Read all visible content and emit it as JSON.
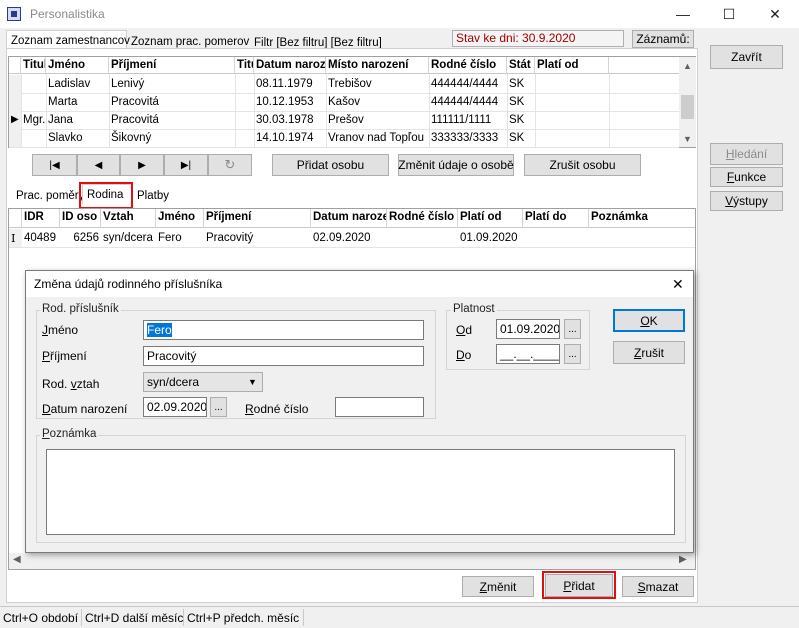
{
  "window": {
    "title": "Personalistika",
    "minimize": "—",
    "maximize": "☐",
    "close": "✕"
  },
  "top_tabs": [
    "Zoznam zamestnancov",
    "Zoznam prac. pomerov",
    "Filtr [Bez filtru] [Bez filtru]"
  ],
  "status_date": "Stav ke dni: 30.9.2020",
  "zaznamu_label": "Záznamů:",
  "zavrit_label": "Zavřít",
  "side_buttons": {
    "hledani": "Hledání",
    "funkce": "Funkce",
    "vystupy": "Výstupy"
  },
  "employees": {
    "columns": [
      "Titul",
      "Jméno",
      "Příjmení",
      "Titul",
      "Datum narození",
      "Místo narození",
      "Rodné číslo",
      "Stát",
      "Platí od"
    ],
    "rows": [
      {
        "indicator": "",
        "titul": "",
        "jmeno": "Ladislav",
        "prijmeni": "Lenivý",
        "titul2": "",
        "datum": "08.11.1979",
        "misto": "Trebišov",
        "rc": "444444/4444",
        "stat": "SK",
        "plati": ""
      },
      {
        "indicator": "",
        "titul": "",
        "jmeno": "Marta",
        "prijmeni": "Pracovitá",
        "titul2": "",
        "datum": "10.12.1953",
        "misto": "Kašov",
        "rc": "444444/4444",
        "stat": "SK",
        "plati": ""
      },
      {
        "indicator": "▶",
        "titul": "Mgr.",
        "jmeno": "Jana",
        "prijmeni": "Pracovitá",
        "titul2": "",
        "datum": "30.03.1978",
        "misto": "Prešov",
        "rc": "111111/1111",
        "stat": "SK",
        "plati": ""
      },
      {
        "indicator": "",
        "titul": "",
        "jmeno": "Slavko",
        "prijmeni": "Šikovný",
        "titul2": "",
        "datum": "14.10.1974",
        "misto": "Vranov nad Topľou",
        "rc": "333333/3333",
        "stat": "SK",
        "plati": ""
      }
    ]
  },
  "nav": {
    "first": "|◀",
    "prev": "◀",
    "next": "▶",
    "last": "▶|",
    "refresh": "↻"
  },
  "person_buttons": {
    "add": "Přidat osobu",
    "edit": "Změnit údaje o osobě",
    "cancel": "Zrušit osobu"
  },
  "sub_tabs": [
    "Prac. poměry",
    "Rodina",
    "Platby"
  ],
  "family": {
    "columns": [
      "IDR",
      "ID oso",
      "Vztah",
      "Jméno",
      "Příjmení",
      "Datum narození",
      "Rodné číslo",
      "Platí od",
      "Platí do",
      "Poznámka"
    ],
    "rows": [
      {
        "indicator": "I",
        "idr": "40489",
        "idoso": "6256",
        "vztah": "syn/dcera",
        "jmeno": "Fero",
        "prijmeni": "Pracovitý",
        "datum": "02.09.2020",
        "rc": "",
        "od": "01.09.2020",
        "do": "",
        "pozn": ""
      }
    ]
  },
  "bottom_buttons": {
    "zmenit": "Změnit",
    "pridat": "Přidat",
    "smazat": "Smazat"
  },
  "dialog": {
    "title": "Změna údajů rodinného příslušníka",
    "close": "✕",
    "group_rod": "Rod. příslušník",
    "jmeno_label": "Jméno",
    "jmeno_value": "Fero",
    "prijmeni_label": "Příjmení",
    "prijmeni_value": "Pracovitý",
    "vztah_label": "Rod. vztah",
    "vztah_value": "syn/dcera",
    "datum_label": "Datum narození",
    "datum_value": "02.09.2020",
    "rc_label": "Rodné číslo",
    "rc_value": "",
    "group_platnost": "Platnost",
    "od_label": "Od",
    "od_value": "01.09.2020",
    "do_label": "Do",
    "do_value": "__.__.____",
    "dots": "...",
    "ok": "OK",
    "zrusit": "Zrušit",
    "group_poznamka": "Poznámka",
    "poznamka_value": ""
  },
  "statusbar": [
    "Ctrl+O období",
    "Ctrl+D další měsíc",
    "Ctrl+P předch. měsíc"
  ],
  "colors": {
    "highlight_red": "#e01010",
    "status_date_text": "#a00000",
    "selection_blue": "#0078d7"
  }
}
